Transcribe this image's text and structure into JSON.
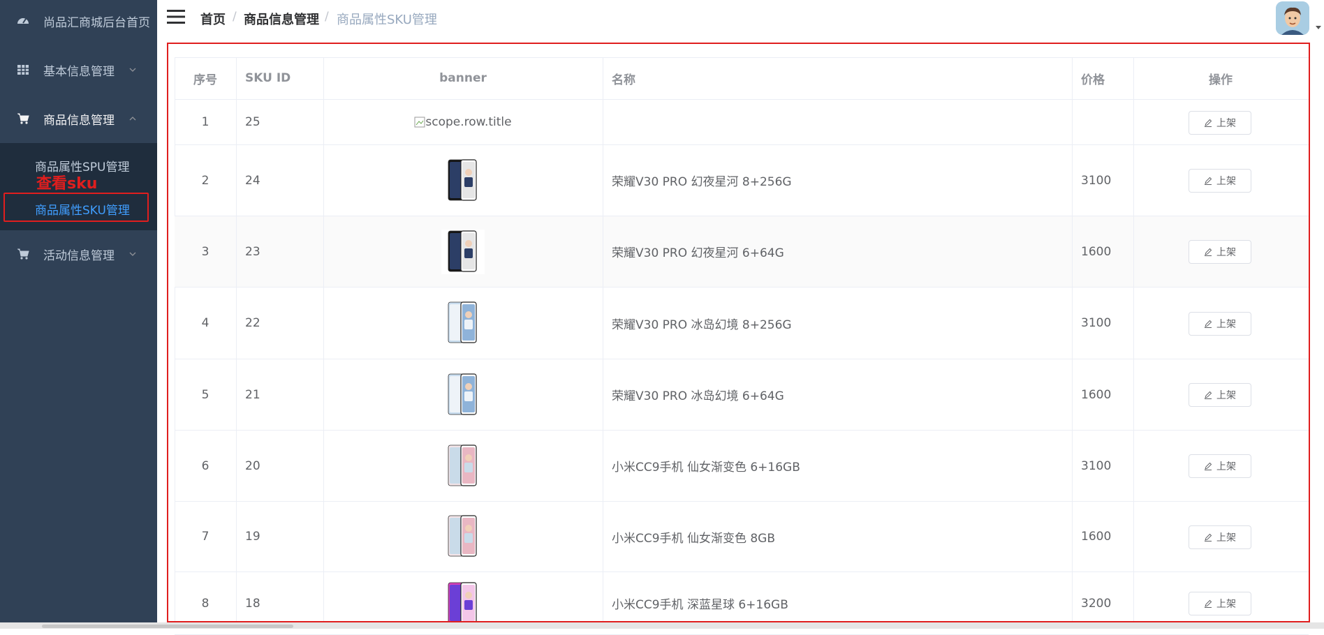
{
  "sidebar": {
    "home": "尚品汇商城后台首页",
    "menus": [
      {
        "label": "基本信息管理",
        "icon": "table-icon"
      },
      {
        "label": "商品信息管理",
        "icon": "cart-icon"
      },
      {
        "label": "活动信息管理",
        "icon": "cart-icon"
      }
    ],
    "submenu": [
      {
        "label": "商品属性SPU管理"
      },
      {
        "label": "商品属性SKU管理"
      }
    ],
    "annotation": "查看sku"
  },
  "header": {
    "breadcrumb": [
      "首页",
      "商品信息管理",
      "商品属性SKU管理"
    ],
    "separator": "/"
  },
  "table": {
    "columns": [
      "序号",
      "SKU ID",
      "banner",
      "名称",
      "价格",
      "操作"
    ],
    "action_label": "上架",
    "broken_image_alt": "scope.row.title",
    "rows": [
      {
        "index": "1",
        "sku_id": "25",
        "name": "",
        "price": "",
        "phone": "none"
      },
      {
        "index": "2",
        "sku_id": "24",
        "name": "荣耀V30 PRO 幻夜星河 8+256G",
        "price": "3100",
        "phone": "black"
      },
      {
        "index": "3",
        "sku_id": "23",
        "name": "荣耀V30 PRO 幻夜星河 6+64G",
        "price": "1600",
        "phone": "black"
      },
      {
        "index": "4",
        "sku_id": "22",
        "name": "荣耀V30 PRO 冰岛幻境 8+256G",
        "price": "3100",
        "phone": "blue"
      },
      {
        "index": "5",
        "sku_id": "21",
        "name": "荣耀V30 PRO 冰岛幻境 6+64G",
        "price": "1600",
        "phone": "blue"
      },
      {
        "index": "6",
        "sku_id": "20",
        "name": "小米CC9手机 仙女渐变色 6+16GB",
        "price": "3100",
        "phone": "pink"
      },
      {
        "index": "7",
        "sku_id": "19",
        "name": "小米CC9手机 仙女渐变色 8GB",
        "price": "1600",
        "phone": "pink"
      },
      {
        "index": "8",
        "sku_id": "18",
        "name": "小米CC9手机 深蓝星球 6+16GB",
        "price": "3200",
        "phone": "gradient"
      }
    ]
  },
  "colors": {
    "sidebar_bg": "#304156",
    "accent": "#409eff",
    "annotation": "#e01e1e"
  }
}
